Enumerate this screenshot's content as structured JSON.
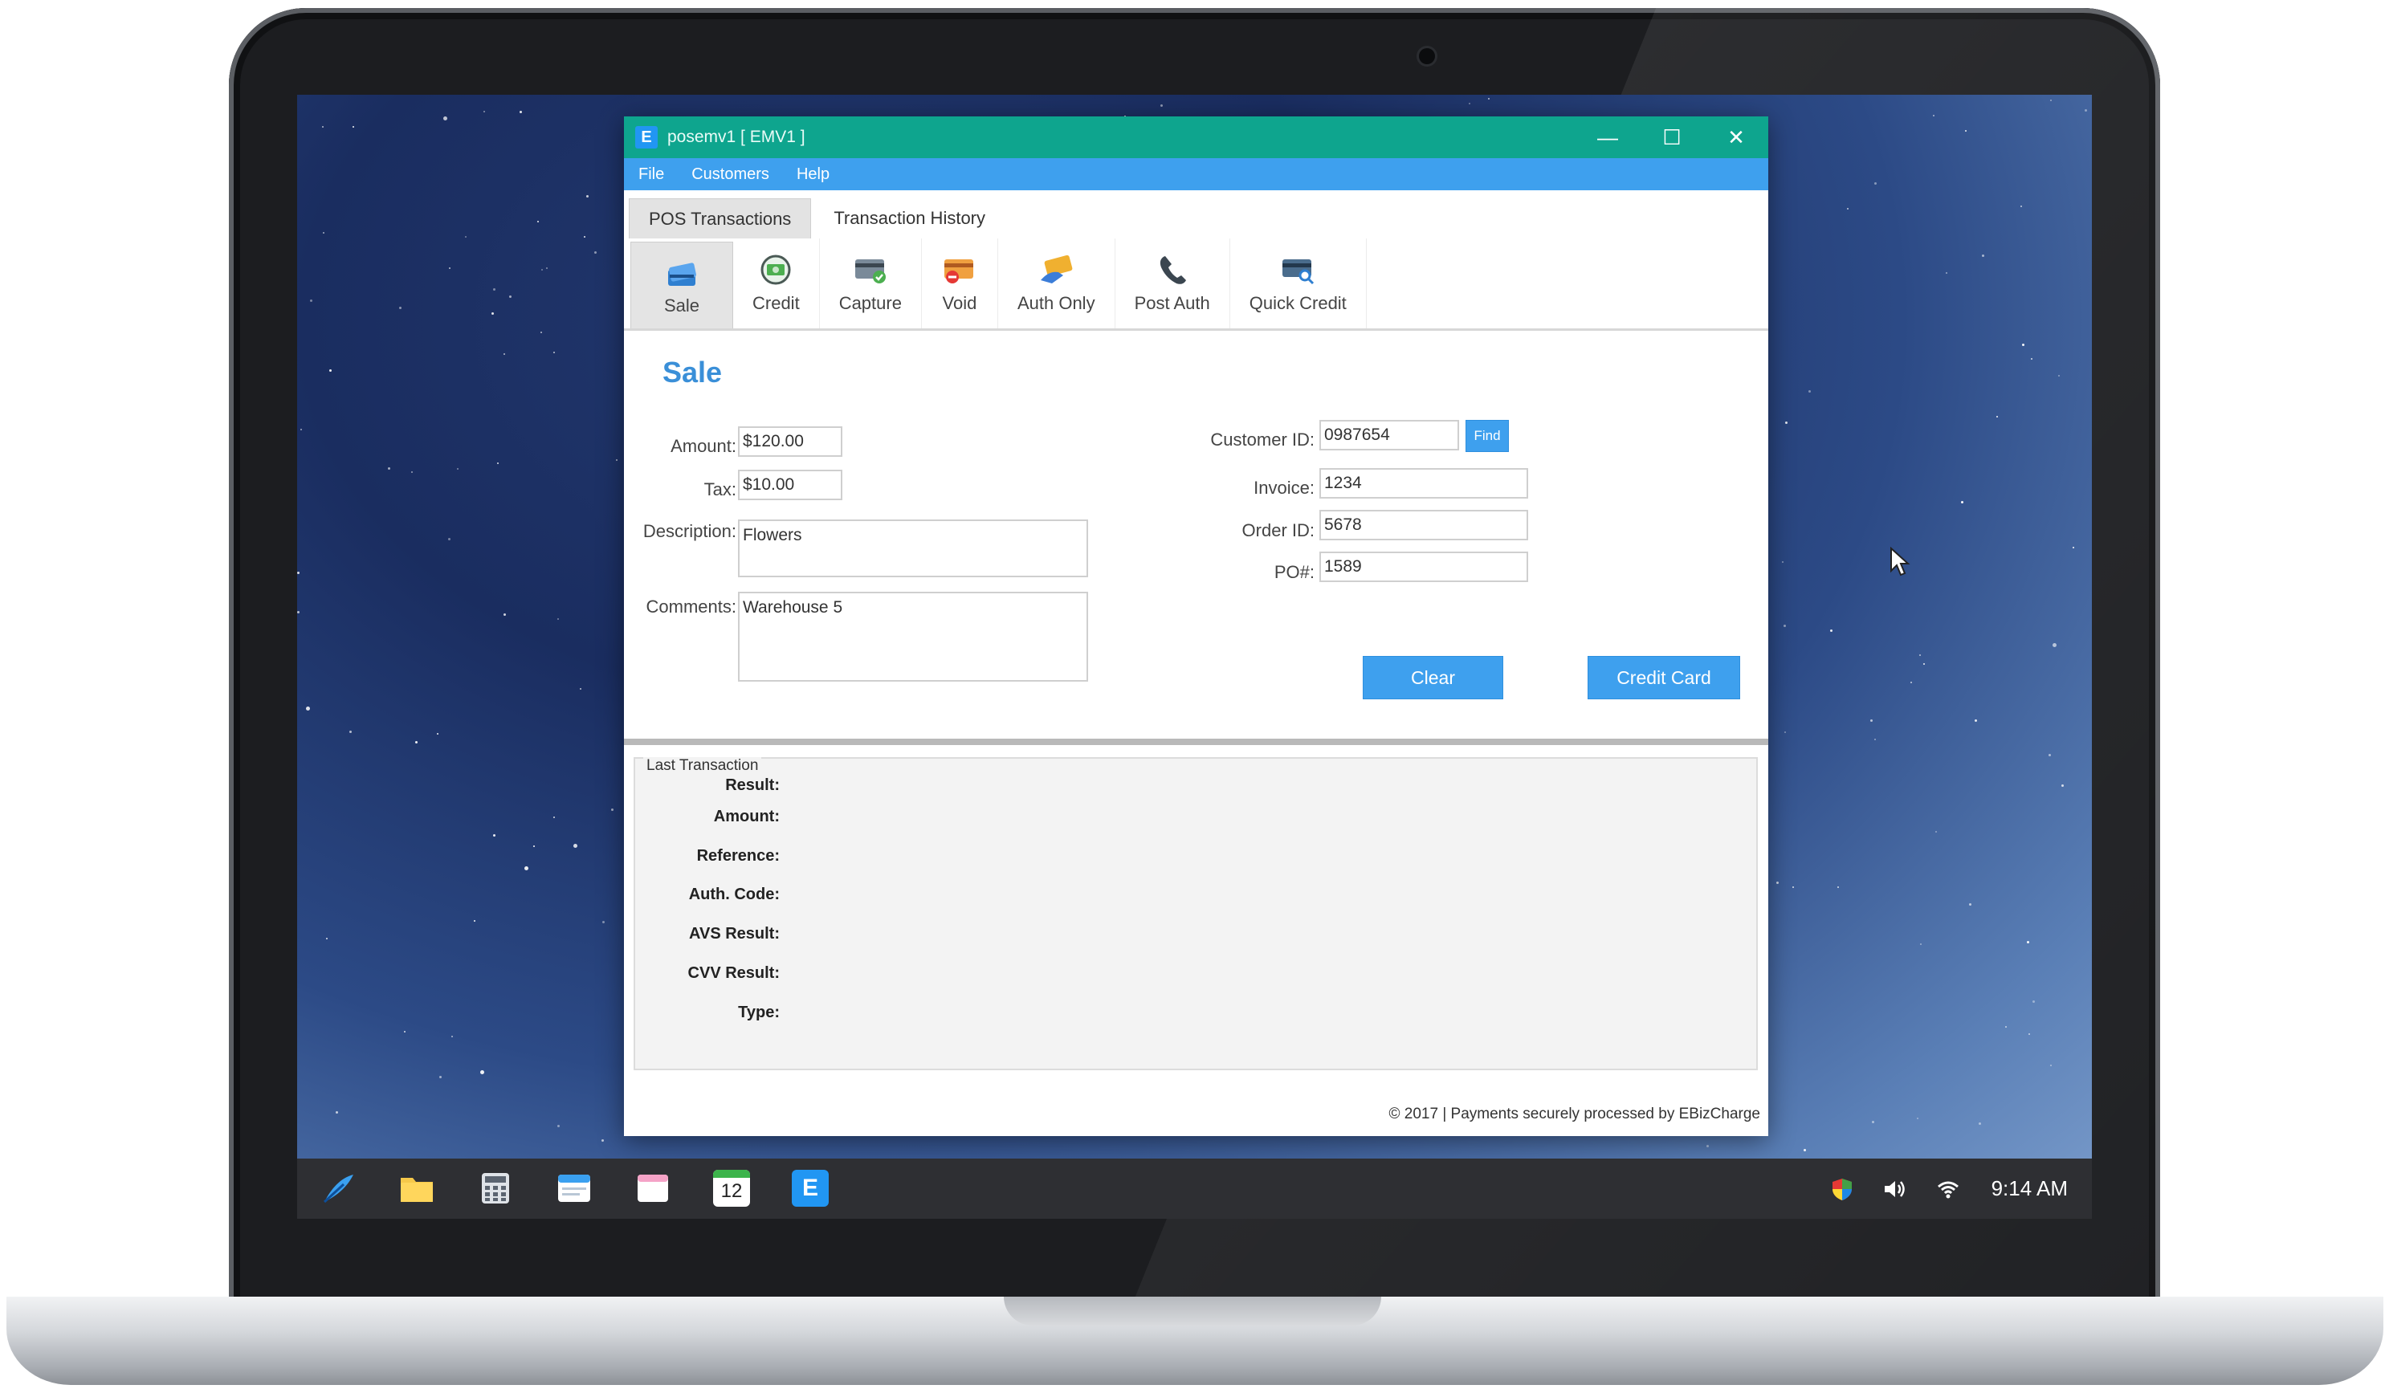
{
  "window": {
    "title": "posemv1   [ EMV1 ]",
    "app_icon": "E",
    "controls": {
      "minimize": "—",
      "maximize": "☐",
      "close": "✕"
    }
  },
  "menu": [
    "File",
    "Customers",
    "Help"
  ],
  "tabs": [
    {
      "label": "POS Transactions",
      "active": true
    },
    {
      "label": "Transaction History",
      "active": false
    }
  ],
  "toolbar": [
    {
      "label": "Sale",
      "icon": "card-stack-icon",
      "active": true
    },
    {
      "label": "Credit",
      "icon": "cash-credit-icon",
      "active": false
    },
    {
      "label": "Capture",
      "icon": "card-check-icon",
      "active": false
    },
    {
      "label": "Void",
      "icon": "card-void-icon",
      "active": false
    },
    {
      "label": "Auth Only",
      "icon": "card-swipe-icon",
      "active": false
    },
    {
      "label": "Post Auth",
      "icon": "phone-icon",
      "active": false
    },
    {
      "label": "Quick Credit",
      "icon": "card-search-icon",
      "active": false
    }
  ],
  "sale": {
    "title": "Sale",
    "amount_label": "Amount:",
    "amount": "$120.00",
    "tax_label": "Tax:",
    "tax": "$10.00",
    "description_label": "Description:",
    "description": "Flowers",
    "comments_label": "Comments:",
    "comments": "Warehouse 5",
    "customer_id_label": "Customer ID:",
    "customer_id": "0987654",
    "find_label": "Find",
    "invoice_label": "Invoice:",
    "invoice": "1234",
    "order_id_label": "Order ID:",
    "order_id": "5678",
    "po_label": "PO#:",
    "po": "1589",
    "clear_label": "Clear",
    "credit_card_label": "Credit Card"
  },
  "last_transaction": {
    "title": "Last Transaction",
    "labels": [
      "Result:",
      "Amount:",
      "Reference:",
      "Auth. Code:",
      "AVS Result:",
      "CVV Result:",
      "Type:"
    ]
  },
  "footer": "© 2017 | Payments securely processed by EBizCharge",
  "taskbar": {
    "apps": [
      "feather-icon",
      "folder-icon",
      "calculator-icon",
      "browser-icon",
      "notes-icon",
      "calendar-icon",
      "app-e-icon"
    ],
    "calendar_day": "12",
    "time": "9:14 AM"
  },
  "colors": {
    "titlebar": "#0ea58e",
    "menubar": "#3ea0ee",
    "accent": "#3a8fd8",
    "button": "#3ea0ee"
  }
}
